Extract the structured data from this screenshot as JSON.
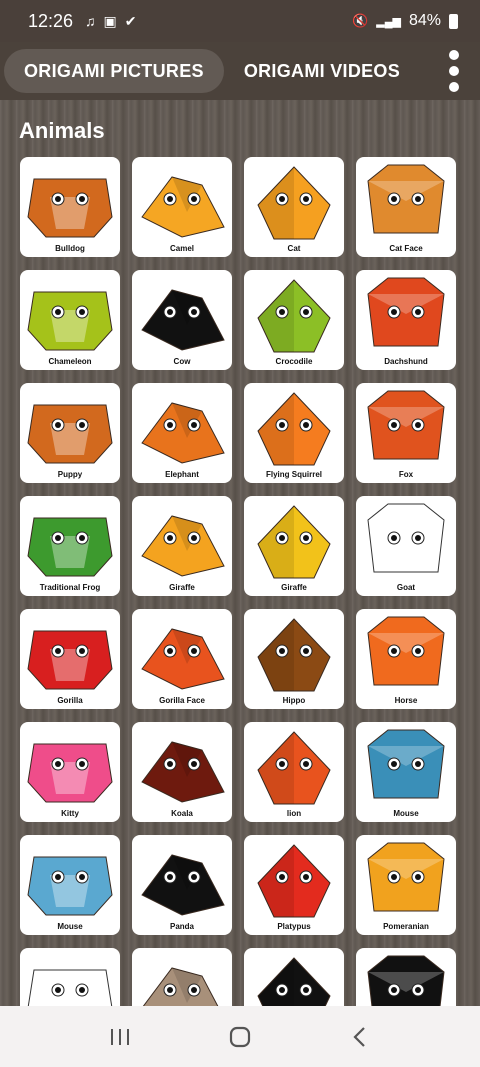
{
  "status": {
    "time": "12:26",
    "battery": "84%"
  },
  "tabs": [
    {
      "label": "ORIGAMI PICTURES"
    },
    {
      "label": "ORIGAMI VIDEOS"
    }
  ],
  "section": {
    "title": "Animals"
  },
  "items": [
    {
      "label": "Bulldog",
      "color": "#d2691e"
    },
    {
      "label": "Camel",
      "color": "#f5a623"
    },
    {
      "label": "Cat",
      "color": "#f5a020"
    },
    {
      "label": "Cat Face",
      "color": "#e08a2e"
    },
    {
      "label": "Chameleon",
      "color": "#a5c21a"
    },
    {
      "label": "Cow",
      "color": "#111111"
    },
    {
      "label": "Crocodile",
      "color": "#8cbf26"
    },
    {
      "label": "Dachshund",
      "color": "#e0481e"
    },
    {
      "label": "Puppy",
      "color": "#d2691e"
    },
    {
      "label": "Elephant",
      "color": "#e8731c"
    },
    {
      "label": "Flying Squirrel",
      "color": "#f57c1f"
    },
    {
      "label": "Fox",
      "color": "#e0531e"
    },
    {
      "label": "Traditional Frog",
      "color": "#3d9a2e"
    },
    {
      "label": "Giraffe",
      "color": "#f4a31f"
    },
    {
      "label": "Giraffe",
      "color": "#f2c21a"
    },
    {
      "label": "Goat",
      "color": "#ffffff"
    },
    {
      "label": "Gorilla",
      "color": "#d81f1f"
    },
    {
      "label": "Gorilla Face",
      "color": "#e8531e"
    },
    {
      "label": "Hippo",
      "color": "#8b4a14"
    },
    {
      "label": "Horse",
      "color": "#f06a1e"
    },
    {
      "label": "Kitty",
      "color": "#ef4d8a"
    },
    {
      "label": "Koala",
      "color": "#6e1a0e"
    },
    {
      "label": "lion",
      "color": "#e8531e"
    },
    {
      "label": "Mouse",
      "color": "#3a8fb8"
    },
    {
      "label": "Mouse",
      "color": "#5aa8d0"
    },
    {
      "label": "Panda",
      "color": "#111111"
    },
    {
      "label": "Platypus",
      "color": "#e32b1e"
    },
    {
      "label": "Pomeranian",
      "color": "#f1a21e"
    },
    {
      "label": "",
      "color": "#ffffff"
    },
    {
      "label": "",
      "color": "#a8907a"
    },
    {
      "label": "",
      "color": "#111111"
    },
    {
      "label": "",
      "color": "#111111"
    }
  ]
}
